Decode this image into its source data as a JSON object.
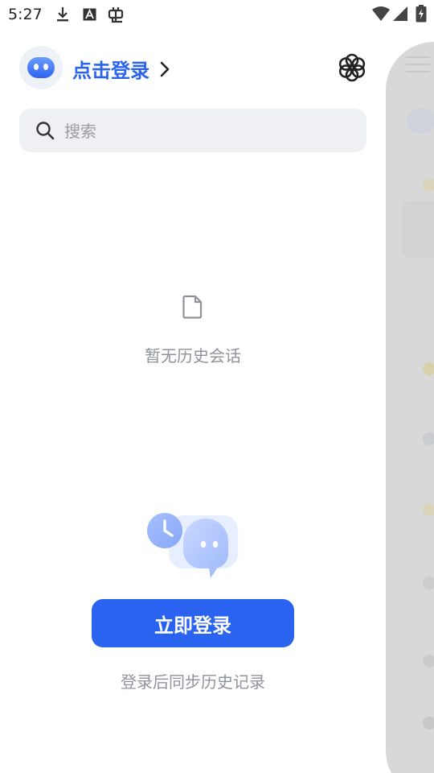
{
  "status_bar": {
    "time": "5:27",
    "icons": [
      "download-icon",
      "font-a-icon",
      "bug-icon",
      "wifi-icon",
      "signal-icon",
      "battery-icon"
    ]
  },
  "header": {
    "login_label": "点击登录",
    "avatar_icon": "robot-face-icon",
    "settings_icon": "flower-settings-icon"
  },
  "search": {
    "placeholder": "搜索",
    "value": ""
  },
  "empty_state": {
    "icon": "document-icon",
    "text": "暂无历史会话"
  },
  "login_prompt": {
    "illustration": "clock-chat-illustration",
    "button_label": "立即登录",
    "hint": "登录后同步历史记录"
  },
  "colors": {
    "accent": "#2a63f0",
    "muted_text": "#8f939b",
    "search_bg": "#eef0f4"
  }
}
